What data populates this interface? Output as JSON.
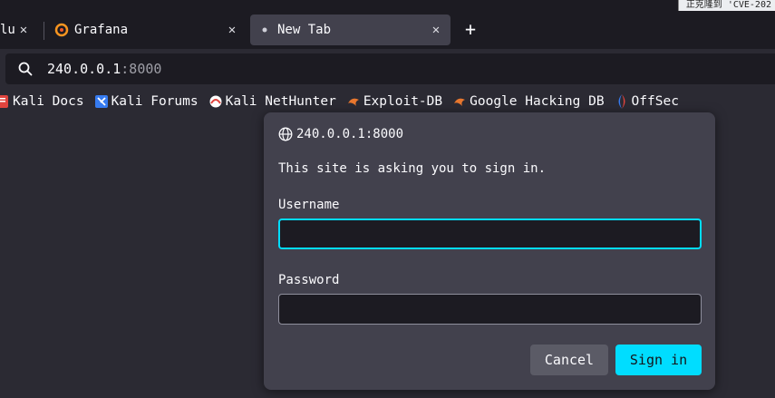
{
  "window": {
    "title_fragment": "正克隆到 'CVE-202"
  },
  "tabs": [
    {
      "label": "lucc",
      "icon": "tab-favicon",
      "active": false
    },
    {
      "label": "Grafana",
      "icon": "grafana-icon",
      "active": false
    },
    {
      "label": "New Tab",
      "icon": "dot-icon",
      "active": true
    }
  ],
  "urlbar": {
    "host": "240.0.0.1",
    "port": ":8000"
  },
  "bookmarks": [
    {
      "label": "Kali Docs",
      "icon": "kali-docs-icon"
    },
    {
      "label": "Kali Forums",
      "icon": "kali-forums-icon"
    },
    {
      "label": "Kali NetHunter",
      "icon": "nethunter-icon"
    },
    {
      "label": "Exploit-DB",
      "icon": "exploit-db-icon"
    },
    {
      "label": "Google Hacking DB",
      "icon": "ghdb-icon"
    },
    {
      "label": "OffSec",
      "icon": "offsec-icon"
    }
  ],
  "dialog": {
    "origin": "240.0.0.1:8000",
    "message": "This site is asking you to sign in.",
    "username_label": "Username",
    "username_value": "",
    "password_label": "Password",
    "password_value": "",
    "cancel_label": "Cancel",
    "signin_label": "Sign in"
  },
  "colors": {
    "accent": "#00ddff",
    "dialog_bg": "#42414d",
    "toolbar_bg": "#2b2a33",
    "tabstrip_bg": "#1c1b22"
  }
}
